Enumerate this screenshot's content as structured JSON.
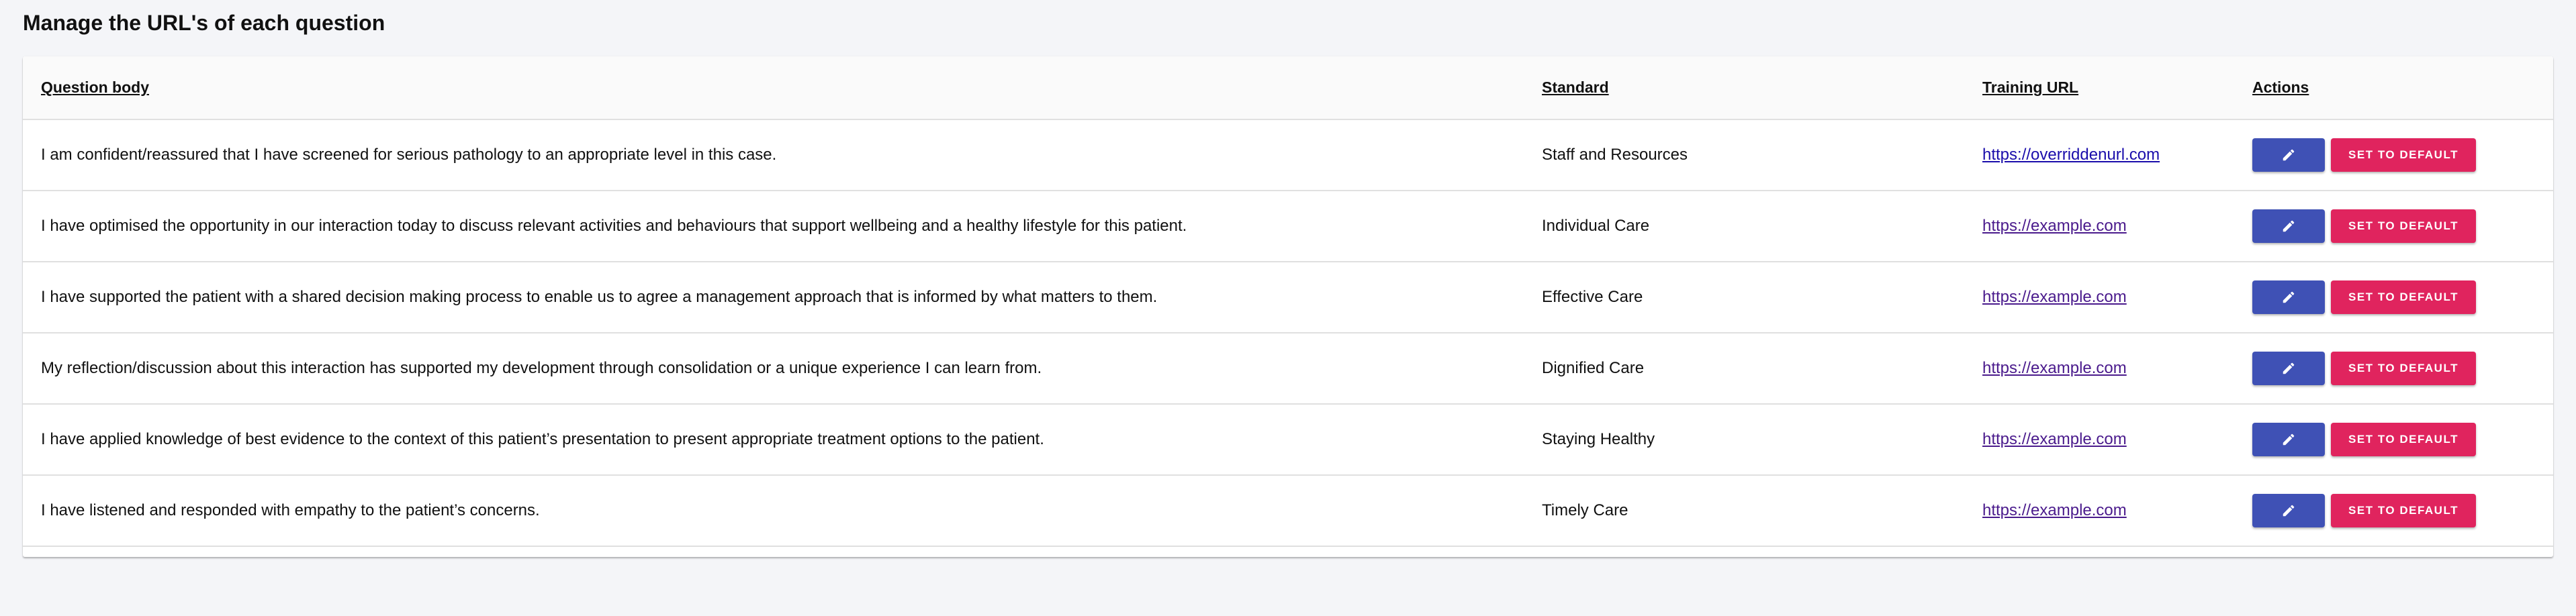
{
  "page": {
    "title": "Manage the URL's of each question"
  },
  "table": {
    "headers": {
      "question_body": "Question body",
      "standard": "Standard",
      "training_url": "Training URL",
      "actions": "Actions"
    },
    "rows": [
      {
        "question": "I am confident/reassured that I have screened for serious pathology to an appropriate level in this case.",
        "standard": "Staff and Resources",
        "url": "https://overriddenurl.com"
      },
      {
        "question": "I have optimised the opportunity in our interaction today to discuss relevant activities and behaviours that support wellbeing and a healthy lifestyle for this patient.",
        "standard": "Individual Care",
        "url": "https://example.com"
      },
      {
        "question": "I have supported the patient with a shared decision making process to enable us to agree a management approach that is informed by what matters to them.",
        "standard": "Effective Care",
        "url": "https://example.com"
      },
      {
        "question": "My reflection/discussion about this interaction has supported my development through consolidation or a unique experience I can learn from.",
        "standard": "Dignified Care",
        "url": "https://example.com"
      },
      {
        "question": "I have applied knowledge of best evidence to the context of this patient’s presentation to present appropriate treatment options to the patient.",
        "standard": "Staying Healthy",
        "url": "https://example.com"
      },
      {
        "question": "I have listened and responded with empathy to the patient’s concerns.",
        "standard": "Timely Care",
        "url": "https://example.com"
      }
    ],
    "actions": {
      "edit_icon": "pencil-icon",
      "set_default_label": "SET TO DEFAULT"
    }
  },
  "colors": {
    "background": "#f4f5f8",
    "edit_button": "#3f51b5",
    "set_default_button": "#e0245e",
    "link_visited": "#4a1a8c",
    "link": "#1a0dab"
  }
}
